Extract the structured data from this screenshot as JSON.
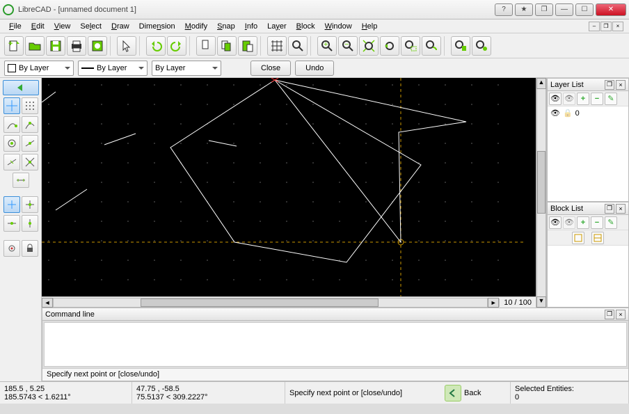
{
  "window": {
    "title": "LibreCAD - [unnamed document 1]"
  },
  "menu": [
    "File",
    "Edit",
    "View",
    "Select",
    "Draw",
    "Dimension",
    "Modify",
    "Snap",
    "Info",
    "Layer",
    "Block",
    "Window",
    "Help"
  ],
  "propbar": {
    "color_combo": "By Layer",
    "width_combo": "By Layer",
    "linetype_combo": "By Layer",
    "close_btn": "Close",
    "undo_btn": "Undo"
  },
  "zoom_label": "10 / 100",
  "layer_panel": {
    "title": "Layer List",
    "rows": [
      {
        "name": "0",
        "visible": true,
        "locked": false
      }
    ]
  },
  "block_panel": {
    "title": "Block List"
  },
  "command_panel": {
    "title": "Command line",
    "prompt": "Specify next point or [close/undo]"
  },
  "status": {
    "abs": "185.5 , 5.25",
    "polar_abs": "185.5743 < 1.6211°",
    "rel": "47.75 , -58.5",
    "polar_rel": "75.5137 < 309.2227°",
    "prompt": "Specify next point or [close/undo]",
    "back_label": "Back",
    "sel_label": "Selected Entities:",
    "sel_count": "0"
  },
  "icons": {
    "new": "new-icon",
    "open": "open-icon",
    "save": "save-icon",
    "print": "print-icon",
    "saveas": "saveas-icon",
    "cursor": "cursor-icon",
    "undo": "undo-icon",
    "redo": "redo-icon",
    "cut": "cut-icon",
    "copy": "copy-icon",
    "paste": "paste-icon",
    "grid": "grid-icon",
    "zoomin": "zoom-in-icon",
    "zoomwin": "zoom-window-icon",
    "pan": "pan-icon",
    "zoomext": "zoom-extents-icon",
    "zoomprev": "zoom-prev-icon",
    "zoomsel": "zoom-sel-icon",
    "zoomauto": "zoom-auto-icon",
    "redraw": "redraw-icon"
  }
}
